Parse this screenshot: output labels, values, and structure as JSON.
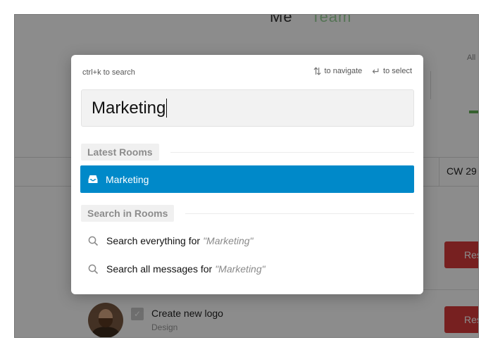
{
  "background": {
    "title_me": "Me",
    "title_team": "Team",
    "filter_all": "All",
    "week_label": "CW 29",
    "action_button_label": "Res",
    "task": {
      "title": "Create new logo",
      "category": "Design",
      "checked": true
    }
  },
  "modal": {
    "hint_shortcut": "ctrl+k to search",
    "hint_navigate": "to navigate",
    "hint_select": "to select",
    "search_value": "Marketing",
    "sections": {
      "latest_rooms": {
        "title": "Latest Rooms",
        "items": [
          {
            "label": "Marketing",
            "icon": "inbox-icon",
            "selected": true
          }
        ]
      },
      "search_in_rooms": {
        "title": "Search in Rooms",
        "items": [
          {
            "prefix": "Search everything for",
            "query": "\"Marketing\"",
            "icon": "search-icon"
          },
          {
            "prefix": "Search all messages for",
            "query": "\"Marketing\"",
            "icon": "search-icon"
          }
        ]
      }
    }
  },
  "colors": {
    "selected_bg": "#0089c9",
    "danger": "#d93b3b",
    "accent_green": "#63b157"
  }
}
